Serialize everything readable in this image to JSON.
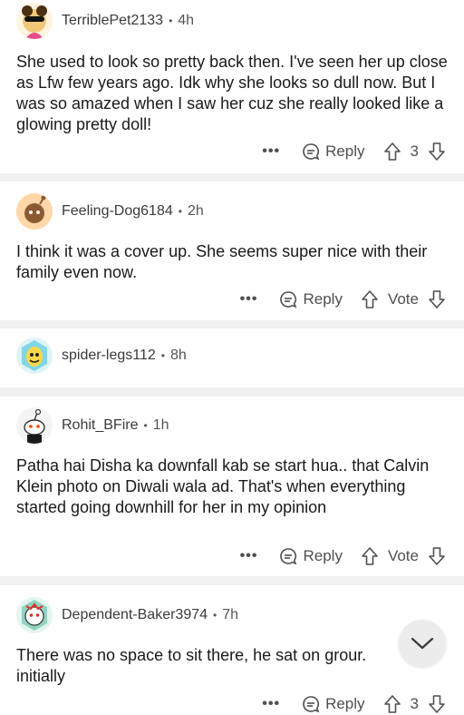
{
  "comments": [
    {
      "username": "TerriblePet2133",
      "age": "4h",
      "text": "She used to look so pretty back then. I've seen her up close as Lfw few years ago. Idk why she looks so dull now. But I was so amazed when I saw her cuz she really looked like a glowing pretty doll!",
      "more": "•••",
      "reply": "Reply",
      "score": "3"
    },
    {
      "username": "Feeling-Dog6184",
      "age": "2h",
      "text": "I think it was a cover up. She seems super nice with their family even now.",
      "more": "•••",
      "reply": "Reply",
      "score": "Vote"
    },
    {
      "username": "spider-legs112",
      "age": "8h"
    },
    {
      "username": "Rohit_BFire",
      "age": "1h",
      "text": "Patha hai Disha ka downfall kab se start hua.. that Calvin Klein photo on Diwali wala ad.  That's when everything started going downhill for her in my opinion",
      "more": "•••",
      "reply": "Reply",
      "score": "Vote"
    },
    {
      "username": "Dependent-Baker3974",
      "age": "7h",
      "text": "There was no space to sit there, he sat on grour. initially",
      "more": "•••",
      "reply": "Reply",
      "score": "3"
    }
  ],
  "separator": "•",
  "icons": {
    "reply": "reply-bubble-icon",
    "upvote": "upvote-arrow-icon",
    "downvote": "downvote-arrow-icon",
    "scroll": "chevron-down-icon"
  },
  "colors": {
    "background": "#f1f1f2",
    "card": "#ffffff",
    "text": "#1a1a1b",
    "meta": "#555555"
  }
}
